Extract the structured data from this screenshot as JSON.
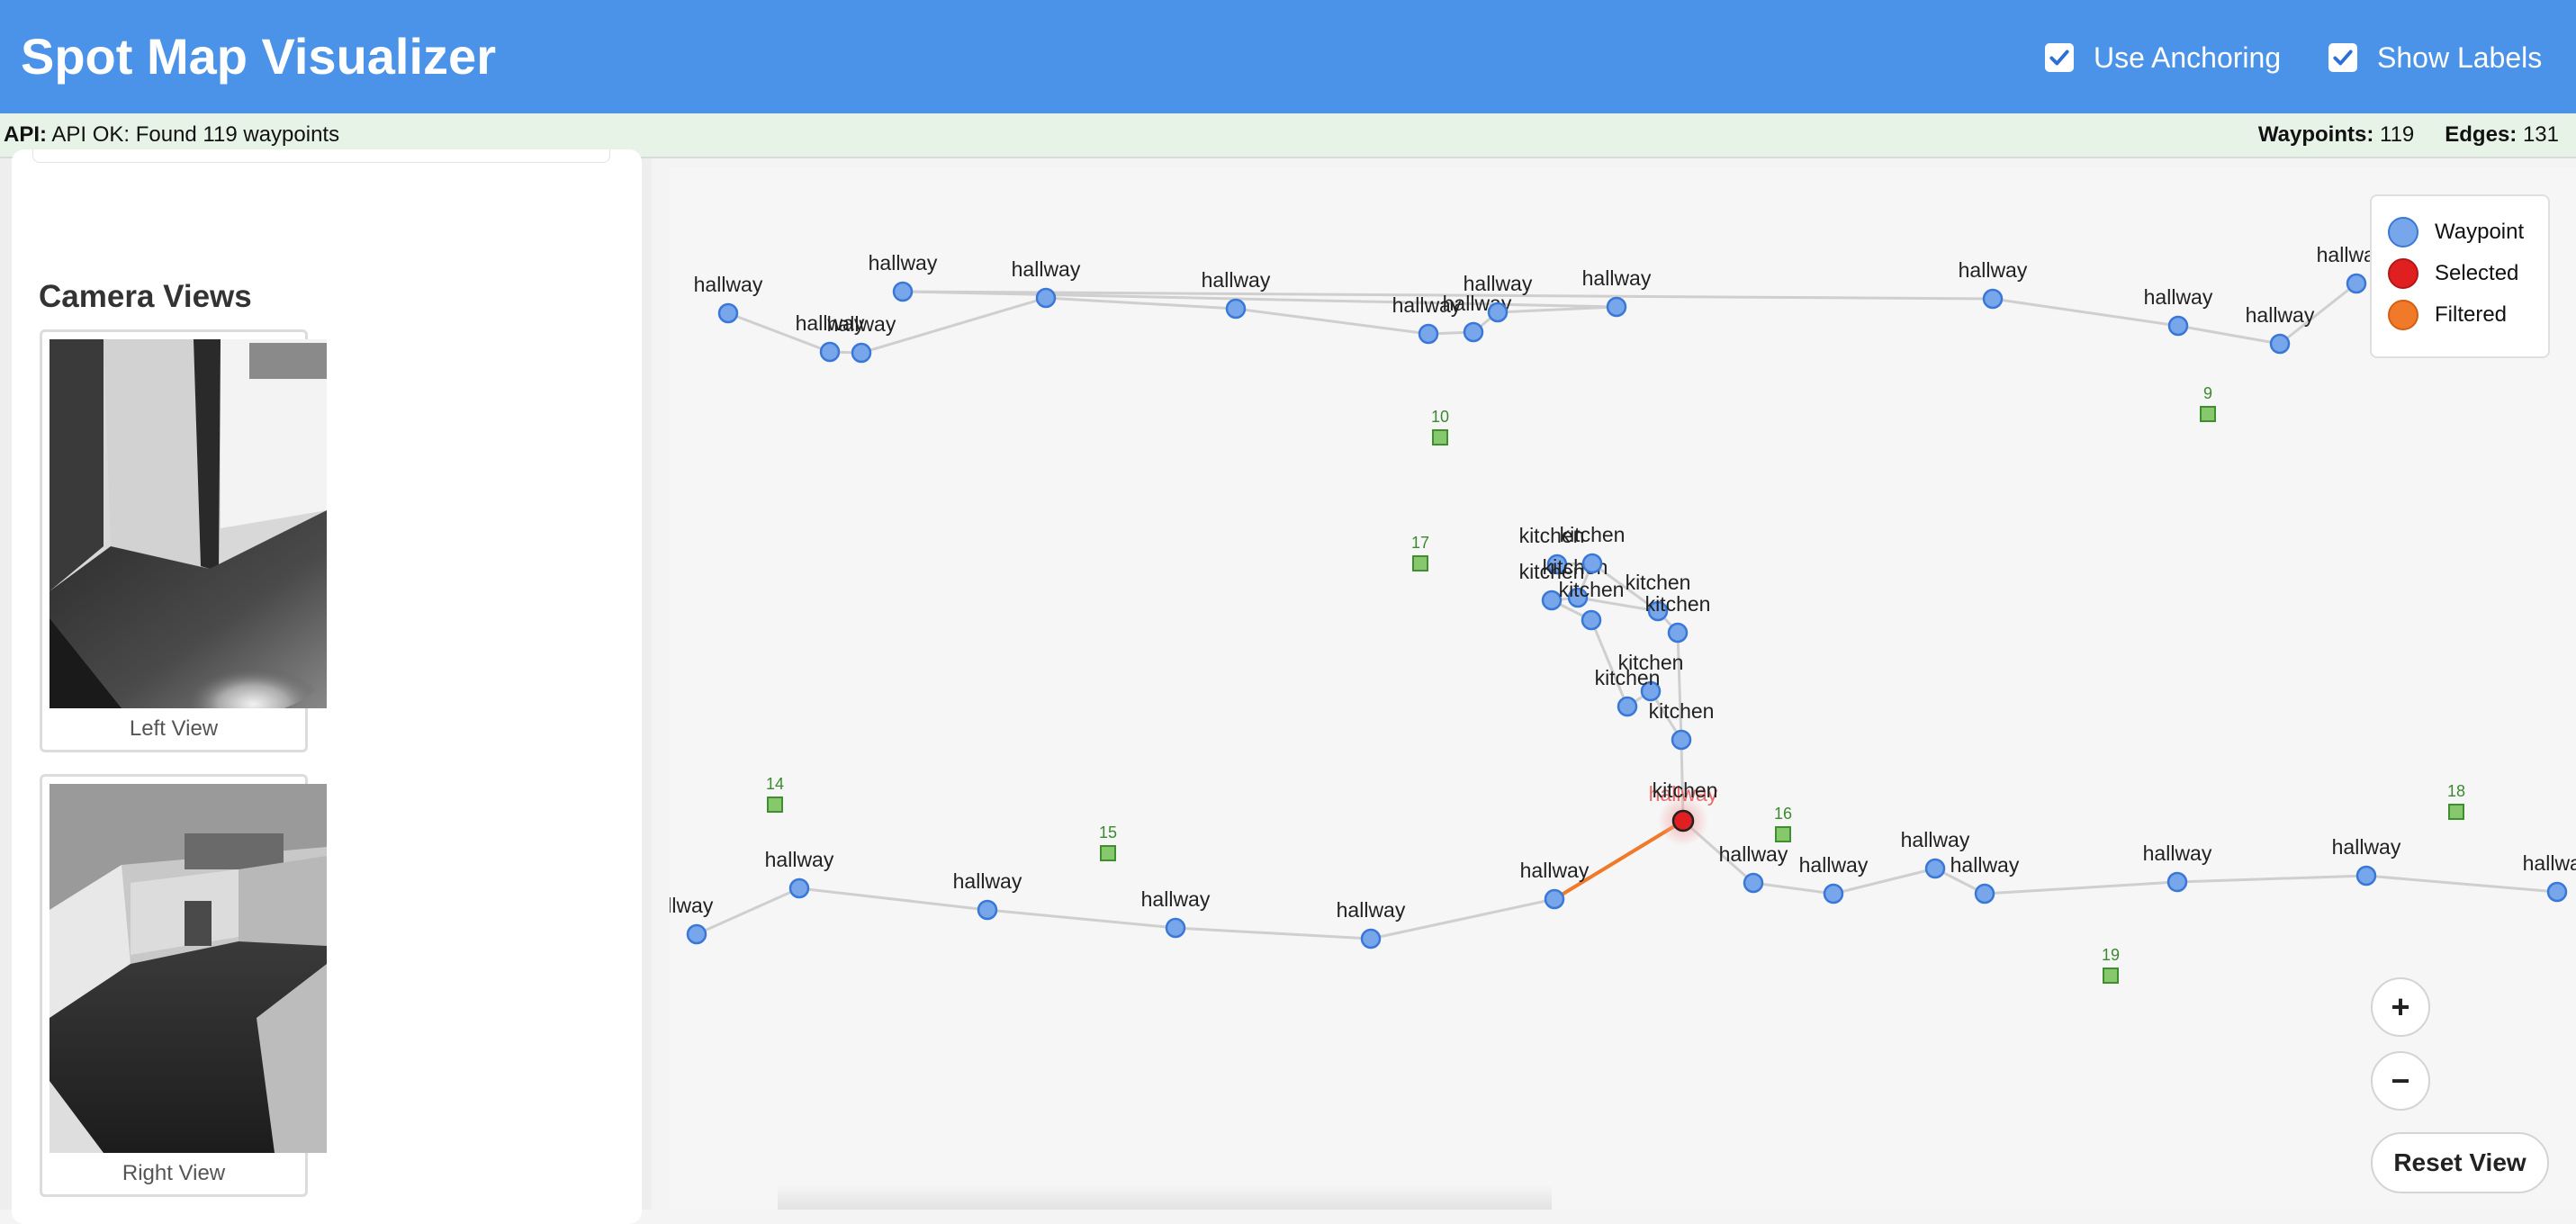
{
  "header": {
    "title": "Spot Map Visualizer",
    "toggles": [
      {
        "label": "Use Anchoring",
        "checked": true
      },
      {
        "label": "Show Labels",
        "checked": true
      }
    ]
  },
  "status": {
    "api_label": "API:",
    "api_message": "API OK: Found 119 waypoints",
    "waypoints_label": "Waypoints:",
    "waypoints_count": "119",
    "edges_label": "Edges:",
    "edges_count": "131"
  },
  "sidebar": {
    "camera_title": "Camera Views",
    "cameras": [
      {
        "label": "Left View"
      },
      {
        "label": "Right View"
      }
    ]
  },
  "map": {
    "colors": {
      "waypoint": "#78a6ea",
      "selected": "#e02020",
      "filtered": "#f07a2a",
      "anchor": "#88c86c",
      "edge": "#cfcfcf"
    },
    "legend": [
      {
        "label": "Waypoint",
        "icon": "waypoint-dot"
      },
      {
        "label": "Selected",
        "icon": "selected-dot"
      },
      {
        "label": "Filtered",
        "icon": "filtered-dot"
      }
    ],
    "waypoint_label_hallway": "hallway",
    "waypoint_label_kitchen": "kitchen",
    "anchor_ids": [
      "10",
      "9",
      "17",
      "14",
      "15",
      "16",
      "18",
      "19"
    ]
  },
  "controls": {
    "zoom_in": "+",
    "zoom_out": "−",
    "reset": "Reset View"
  }
}
